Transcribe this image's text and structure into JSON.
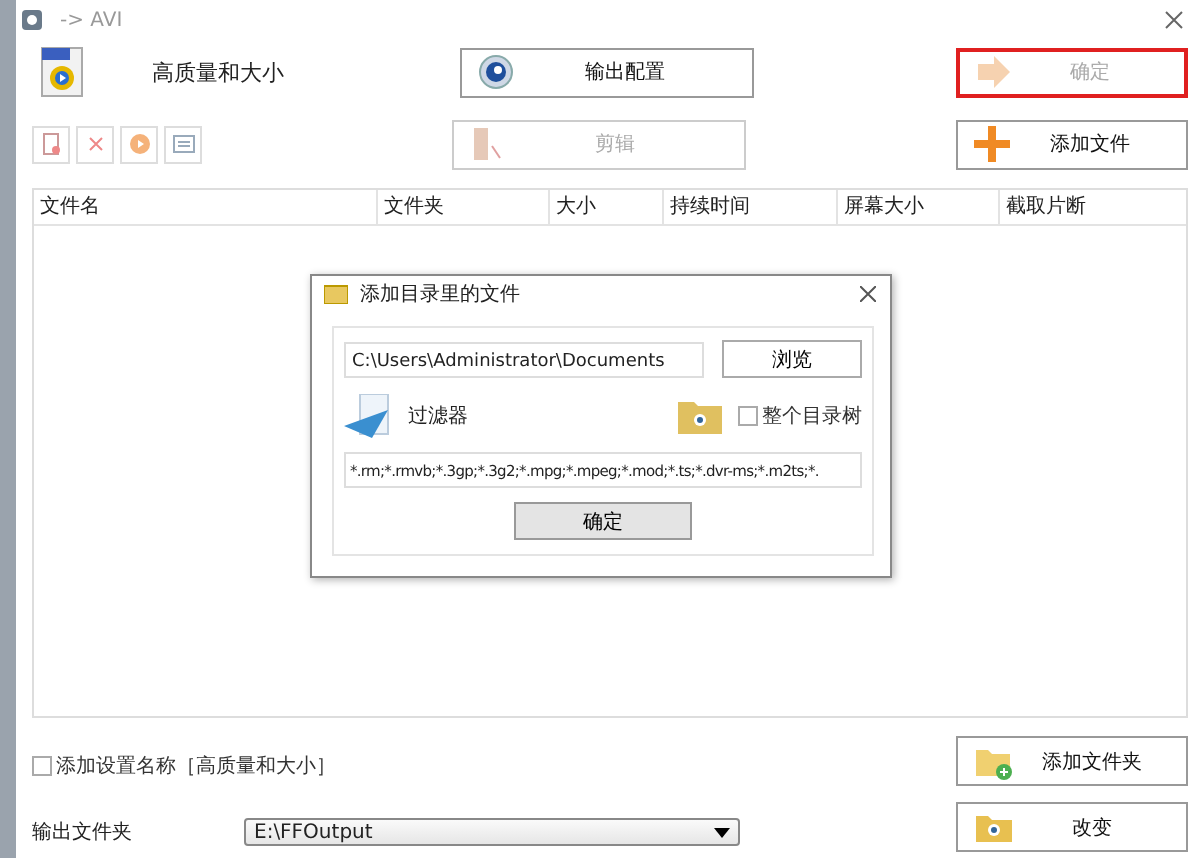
{
  "window": {
    "title": "-> AVI"
  },
  "preset": {
    "label": "高质量和大小"
  },
  "output_config_button": {
    "label": "输出配置",
    "disabled": false
  },
  "confirm_button": {
    "label": "确定",
    "disabled": true
  },
  "toolbar_buttons": [
    {
      "kind": "remove",
      "disabled": true
    },
    {
      "kind": "clear",
      "disabled": true
    },
    {
      "kind": "play",
      "disabled": true
    },
    {
      "kind": "info",
      "disabled": true
    }
  ],
  "cut_button": {
    "label": "剪辑",
    "disabled": true
  },
  "add_file_button": {
    "label": "添加文件",
    "disabled": false
  },
  "table": {
    "columns": [
      "文件名",
      "文件夹",
      "大小",
      "持续时间",
      "屏幕大小",
      "截取片断"
    ]
  },
  "add_preset_name": {
    "label": "添加设置名称［高质量和大小］",
    "checked": false
  },
  "add_folder_button": {
    "label": "添加文件夹",
    "disabled": false
  },
  "output_folder": {
    "label": "输出文件夹",
    "value": "E:\\FFOutput"
  },
  "change_button": {
    "label": "改变",
    "disabled": false
  },
  "dialog": {
    "title": "添加目录里的文件",
    "path": "C:\\Users\\Administrator\\Documents",
    "browse_button": "浏览",
    "filter_label": "过滤器",
    "whole_tree": {
      "label": "整个目录树",
      "checked": false
    },
    "filter": "*.rm;*.rmvb;*.3gp;*.3g2;*.mpg;*.mpeg;*.mod;*.ts;*.dvr-ms;*.m2ts;*.",
    "ok_button": "确定"
  }
}
